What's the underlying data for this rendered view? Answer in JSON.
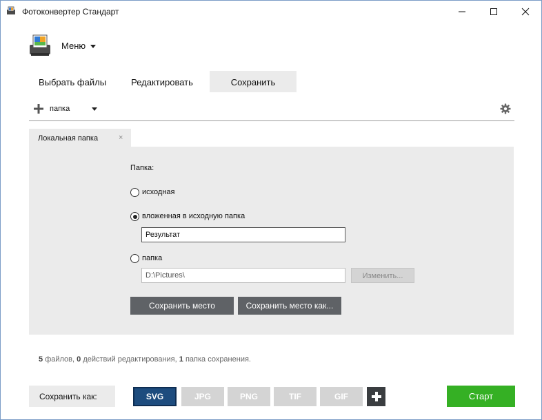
{
  "window": {
    "title": "Фотоконвертер Стандарт",
    "controls": [
      "minimize-icon",
      "maximize-icon",
      "close-icon"
    ]
  },
  "menu": {
    "label": "Меню"
  },
  "tabs": [
    {
      "label": "Выбрать файлы",
      "active": false
    },
    {
      "label": "Редактировать",
      "active": false
    },
    {
      "label": "Сохранить",
      "active": true
    }
  ],
  "toolbar": {
    "add_label": "папка",
    "settings_icon": "gear-icon"
  },
  "panel": {
    "tab_label": "Локальная папка",
    "tab_close": "×",
    "folder_heading": "Папка:",
    "options": [
      {
        "label": "исходная",
        "checked": false
      },
      {
        "label": "вложенная в исходную папка",
        "checked": true
      },
      {
        "label": "папка",
        "checked": false
      }
    ],
    "subfolder_value": "Результат",
    "path_value": "D:\\Pictures\\",
    "change_button": "Изменить...",
    "save_location_button": "Сохранить место",
    "save_location_as_button": "Сохранить место как..."
  },
  "status": {
    "files_count": "5",
    "files_text": "файлов,",
    "edits_count": "0",
    "edits_text": "действий редактирования,",
    "folders_count": "1",
    "folders_text": "папка сохранения."
  },
  "bottom": {
    "save_as_label": "Сохранить как:",
    "formats": [
      {
        "label": "SVG",
        "selected": true
      },
      {
        "label": "JPG",
        "selected": false
      },
      {
        "label": "PNG",
        "selected": false
      },
      {
        "label": "TIF",
        "selected": false
      },
      {
        "label": "GIF",
        "selected": false
      }
    ],
    "start_button": "Старт"
  },
  "colors": {
    "accent_selected_format": "#1d4c7e",
    "start_button": "#35b024",
    "panel_bg": "#ebebeb",
    "dark_button": "#5f6266"
  }
}
